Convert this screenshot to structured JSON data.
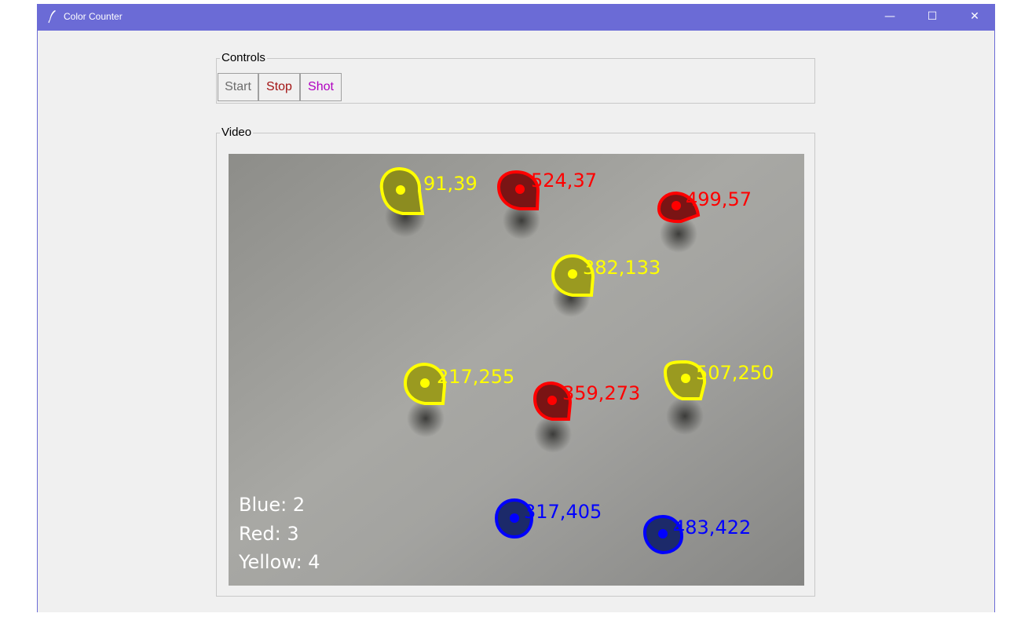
{
  "window": {
    "title": "Color Counter",
    "title_bar_color": "#6b6bd6",
    "icon": "feather-icon",
    "controls": {
      "minimize": "—",
      "maximize": "☐",
      "close": "✕"
    }
  },
  "controls": {
    "legend": "Controls",
    "buttons": {
      "start": "Start",
      "stop": "Stop",
      "shot": "Shot"
    },
    "colors": {
      "start": "#6d6d6d",
      "stop": "#a31515",
      "shot": "#b000c0"
    }
  },
  "video": {
    "legend": "Video",
    "detections": [
      {
        "color": "yellow",
        "label": "91,39"
      },
      {
        "color": "red",
        "label": "524,37"
      },
      {
        "color": "red",
        "label": "499,57"
      },
      {
        "color": "yellow",
        "label": "382,133"
      },
      {
        "color": "yellow",
        "label": "217,255"
      },
      {
        "color": "yellow",
        "label": "507,250"
      },
      {
        "color": "red",
        "label": "359,273"
      },
      {
        "color": "blue",
        "label": "317,405"
      },
      {
        "color": "blue",
        "label": "483,422"
      }
    ],
    "counts": {
      "blue": "Blue: 2",
      "red": "Red: 3",
      "yellow": "Yellow: 4"
    },
    "colors": {
      "yellow": "#ffff00",
      "red": "#ff0000",
      "blue": "#0000ff",
      "count_text": "#ffffff"
    }
  }
}
